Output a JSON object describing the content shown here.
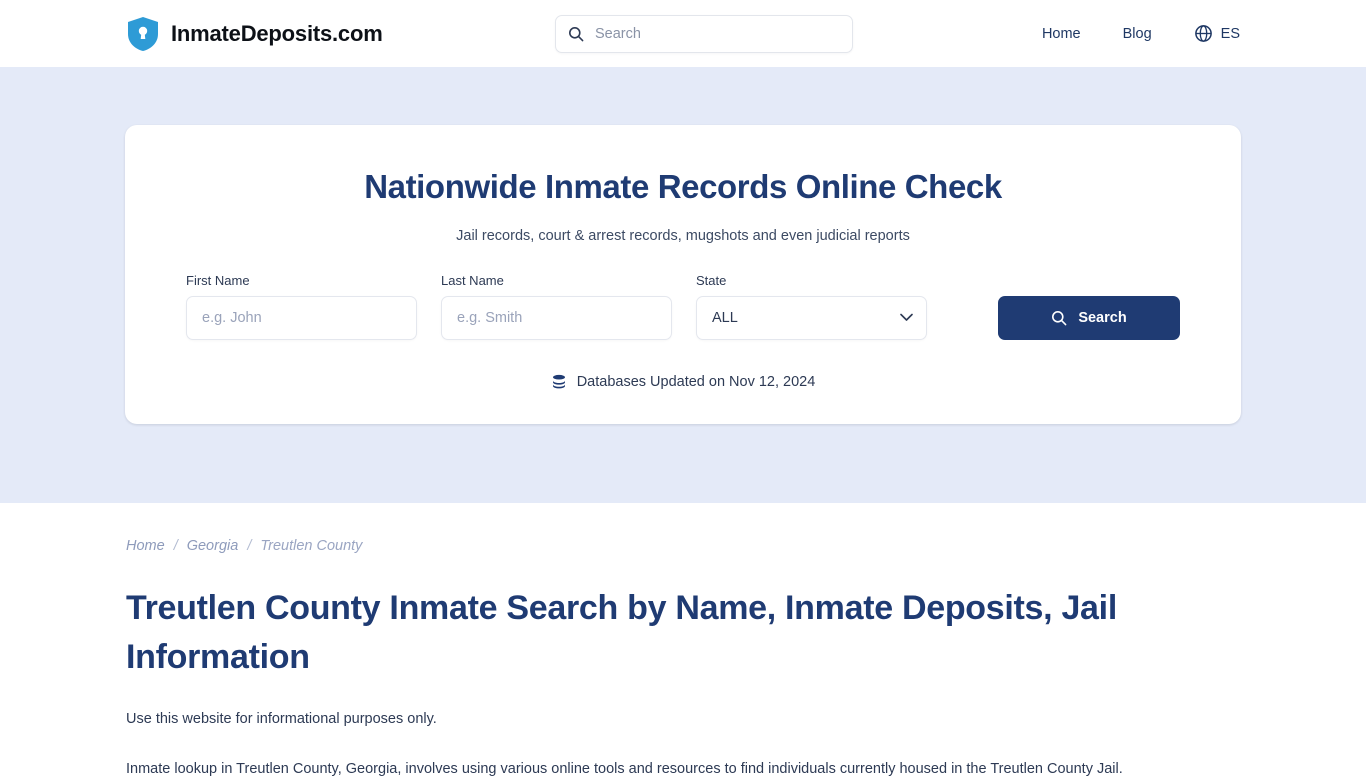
{
  "header": {
    "brand_name": "InmateDeposits.com",
    "logo_icon": "shield-keyhole-icon",
    "search": {
      "placeholder": "Search",
      "value": "",
      "icon": "search-icon"
    },
    "nav": [
      {
        "label": "Home"
      },
      {
        "label": "Blog"
      }
    ],
    "language": {
      "icon": "globe-icon",
      "label": "ES"
    }
  },
  "hero": {
    "title": "Nationwide Inmate Records Online Check",
    "subtitle": "Jail records, court & arrest records, mugshots and even judicial reports",
    "form": {
      "first_name": {
        "label": "First Name",
        "placeholder": "e.g. John",
        "value": ""
      },
      "last_name": {
        "label": "Last Name",
        "placeholder": "e.g. Smith",
        "value": ""
      },
      "state": {
        "label": "State",
        "value": "ALL",
        "options": [
          "ALL"
        ],
        "chevron_icon": "chevron-down-icon"
      },
      "submit": {
        "label": "Search",
        "icon": "search-icon"
      }
    },
    "database_status": {
      "icon": "database-icon",
      "text": "Databases Updated on Nov 12, 2024"
    }
  },
  "main": {
    "breadcrumb": [
      {
        "label": "Home"
      },
      {
        "label": "Georgia"
      },
      {
        "label": "Treutlen County"
      }
    ],
    "breadcrumb_separator": "/",
    "page_title": "Treutlen County Inmate Search by Name, Inmate Deposits, Jail Information",
    "paragraphs": [
      "Use this website for informational purposes only.",
      "Inmate lookup in Treutlen County, Georgia, involves using various online tools and resources to find individuals currently housed in the Treutlen County Jail."
    ]
  },
  "colors": {
    "brand_blue": "#2e9bd6",
    "navy": "#1f3b73",
    "hero_background": "#e4eaf8",
    "text": "#2d3a54",
    "muted": "#8e9bbb"
  }
}
